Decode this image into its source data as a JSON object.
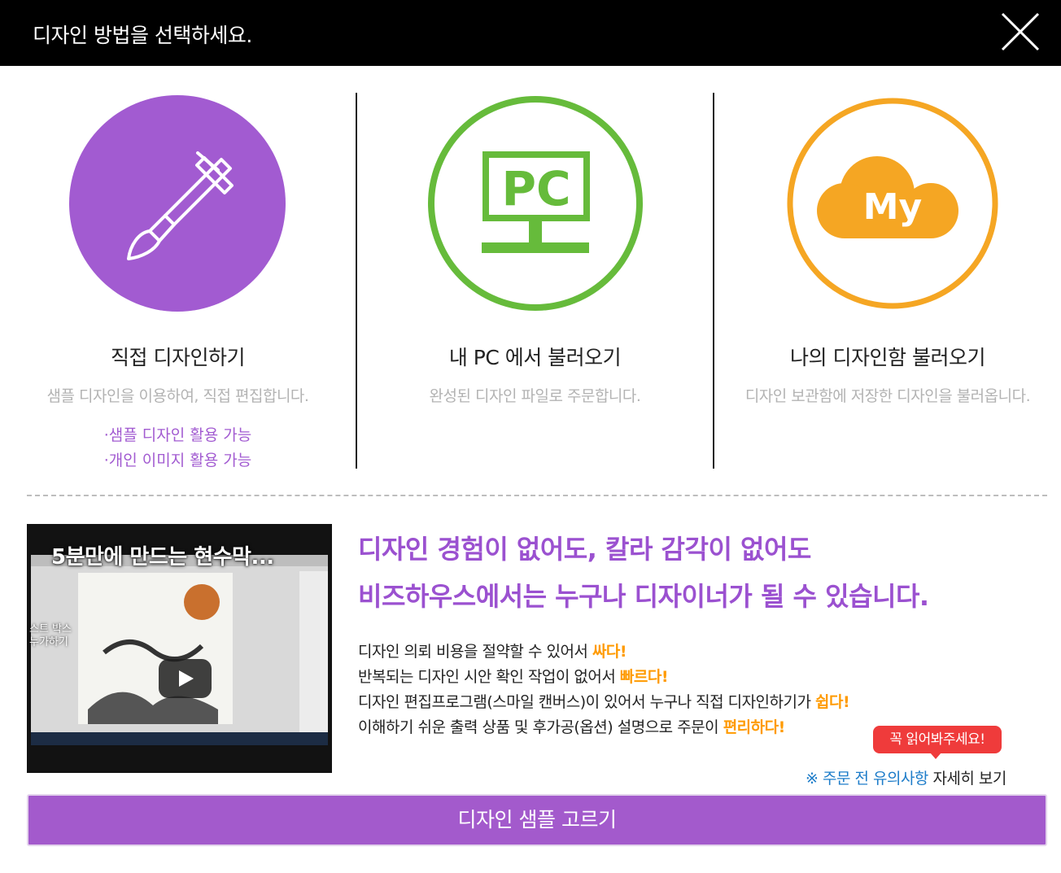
{
  "header": {
    "title": "디자인 방법을 선택하세요."
  },
  "options": [
    {
      "id": "direct",
      "title": "직접 디자인하기",
      "desc": "샘플 디자인을 이용하여, 직접 편집합니다.",
      "features": [
        "·샘플 디자인 활용 가능",
        "·개인 이미지 활용 가능"
      ],
      "icon": "brush-icon",
      "color": "#a25bd1"
    },
    {
      "id": "pc",
      "title": "내 PC 에서 불러오기",
      "desc": "완성된 디자인 파일로 주문합니다.",
      "icon_text": "PC",
      "icon": "pc-monitor-icon",
      "color": "#66bb3b"
    },
    {
      "id": "my",
      "title": "나의 디자인함 불러오기",
      "desc": "디자인 보관함에 저장한 디자인을 불러옵니다.",
      "icon_text": "My",
      "icon": "cloud-icon",
      "color": "#f5a623"
    }
  ],
  "video": {
    "title": "5분만에 만드는 현수막...",
    "side_label": "스트 박스\n누가하기",
    "play_icon": "play-icon"
  },
  "headline": [
    "디자인 경험이 없어도, 칼라 감각이 없어도",
    "비즈하우스에서는 누구나 디자이너가 될 수 있습니다."
  ],
  "benefits": [
    {
      "text": "디자인 의뢰 비용을 절약할 수 있어서 ",
      "emphasis": "싸다!"
    },
    {
      "text": "반복되는 디자인 시안 확인 작업이 없어서 ",
      "emphasis": "빠르다!"
    },
    {
      "text": "디자인 편집프로그램(스마일 캔버스)이 있어서 누구나 직접 디자인하기가 ",
      "emphasis": "쉽다!"
    },
    {
      "text": "이해하기 쉬운 출력 상품 및 후가공(옵션) 설명으로 주문이 ",
      "emphasis": "편리하다!"
    }
  ],
  "notice": {
    "badge": "꼭 읽어봐주세요!",
    "link_prefix": "※ 주문 전 유의사항",
    "link_suffix": " 자세히 보기"
  },
  "cta": {
    "label": "디자인 샘플 고르기"
  },
  "colors": {
    "accent": "#a35acc",
    "green": "#66bb3b",
    "orange": "#f5a623",
    "highlight": "#ff9a00",
    "link": "#1d7cc9",
    "badge": "#ef3b3b"
  }
}
